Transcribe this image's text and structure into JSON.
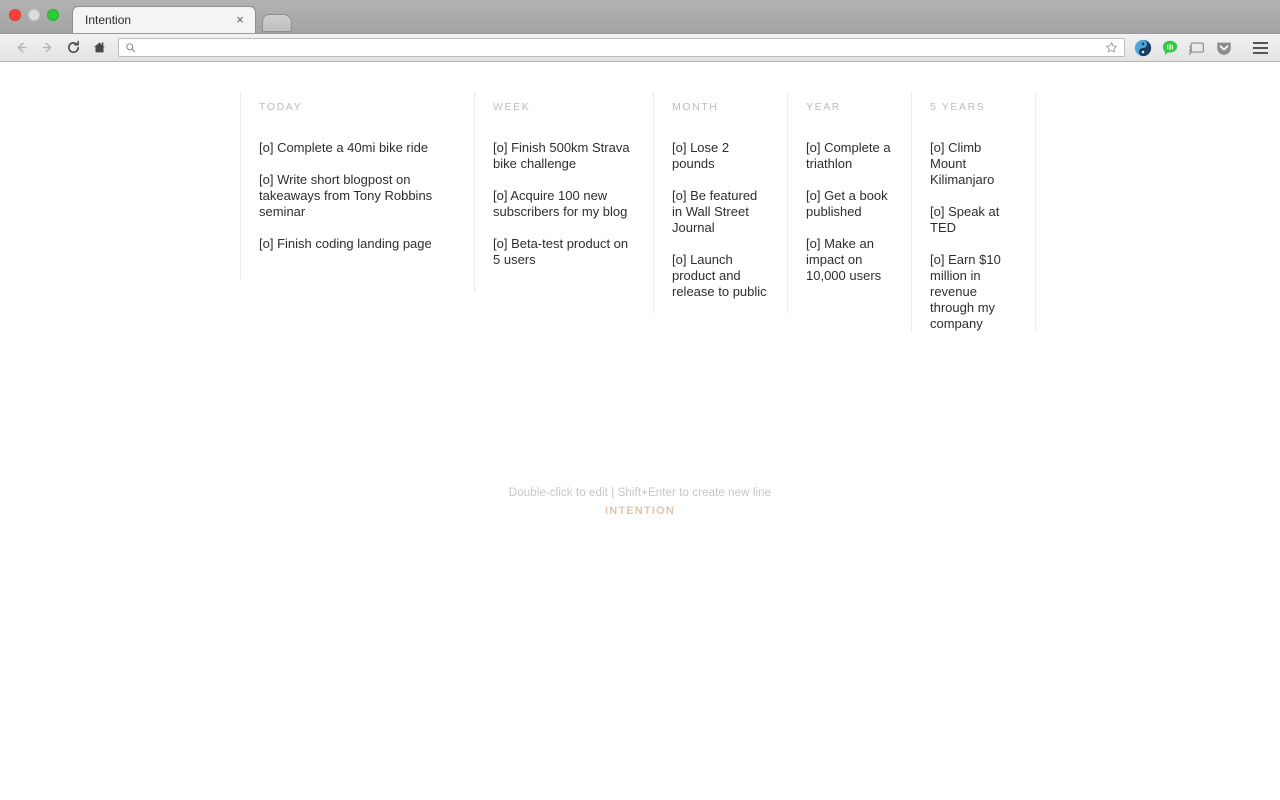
{
  "window": {
    "traffic_lights": [
      "close",
      "minimize",
      "zoom"
    ]
  },
  "browser": {
    "tab": {
      "title": "Intention",
      "close_label": "×"
    },
    "new_tab_name": "new-tab-button",
    "toolbar": {
      "back_label": "←",
      "forward_label": "→",
      "reload_label": "↻",
      "home_label": "⌂",
      "url_value": "",
      "url_placeholder": "",
      "search_icon": "search-icon",
      "bookmark_icon": "star-icon",
      "extensions": [
        "yin-yang-extension-icon",
        "chat-bubble-extension-icon",
        "cast-icon",
        "pocket-icon"
      ],
      "menu_label": "menu-icon"
    }
  },
  "app": {
    "columns": [
      {
        "header": "TODAY",
        "items": [
          "[o] Complete a 40mi bike ride",
          "[o] Write short blogpost on takeaways from Tony Robbins seminar",
          "[o] Finish coding landing page"
        ]
      },
      {
        "header": "WEEK",
        "items": [
          "[o] Finish 500km Strava bike challenge",
          "[o] Acquire 100 new subscribers for my blog",
          "[o] Beta-test product on 5 users"
        ]
      },
      {
        "header": "MONTH",
        "items": [
          "[o] Lose 2 pounds",
          "[o] Be featured in Wall Street Journal",
          "[o] Launch product and release to public"
        ]
      },
      {
        "header": "YEAR",
        "items": [
          "[o] Complete a triathlon",
          "[o] Get a book published",
          "[o] Make an impact on 10,000 users"
        ]
      },
      {
        "header": "5 YEARS",
        "items": [
          "[o] Climb Mount Kilimanjaro",
          "[o] Speak at TED",
          "[o] Earn $10 million in revenue through my company"
        ]
      }
    ],
    "footer": {
      "hint": "Double-click to edit | Shift+Enter to create new line",
      "brand": "INTENTION"
    },
    "colors": {
      "brand": "#ddc6ae",
      "header_text": "#bdbdbd",
      "item_text": "#2e2e2e",
      "divider": "#ececec"
    }
  }
}
